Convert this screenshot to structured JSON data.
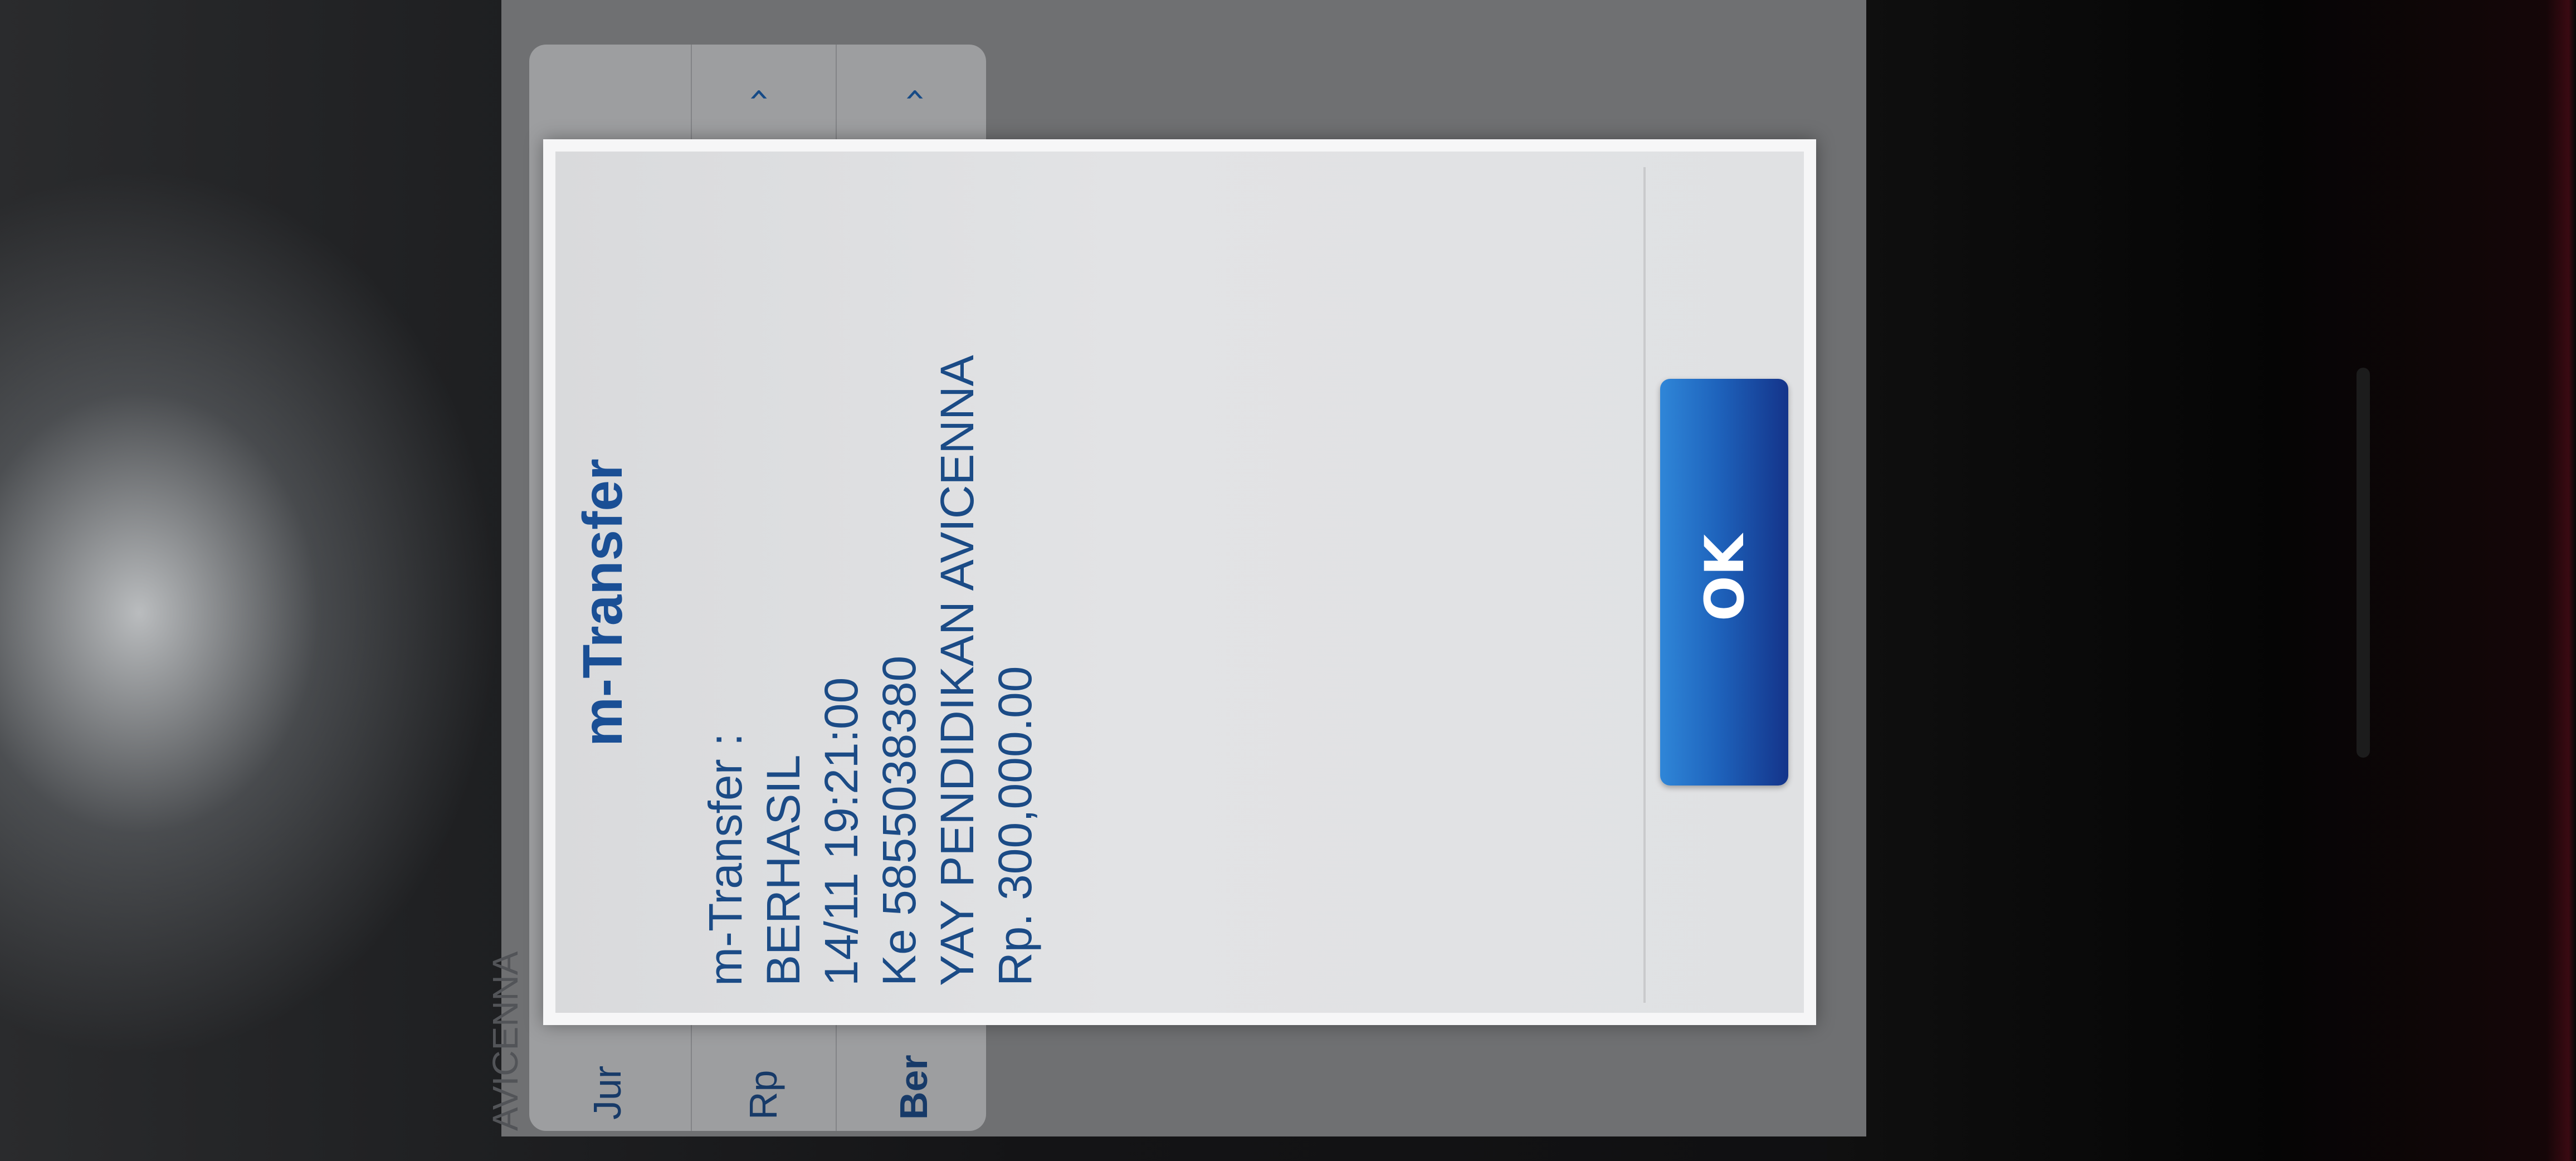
{
  "background_app": {
    "row_labels": [
      "Jur",
      "Rp",
      "Ber"
    ],
    "faded_label": "AVICENNA",
    "chevrons": [
      "chevron-up-icon",
      "chevron-up-icon"
    ]
  },
  "dialog": {
    "title": "m-Transfer",
    "message_lines": [
      "m-Transfer :",
      "BERHASIL",
      "14/11 19:21:00",
      "Ke 5855038380",
      "YAY PENDIDIKAN AVICENNA",
      "Rp. 300,000.00"
    ],
    "ok_label": "OK"
  },
  "colors": {
    "accent": "#1a4f95",
    "button_start": "#2f86d8",
    "button_end": "#14348a",
    "dialog_bg": "#e0e1e3"
  }
}
